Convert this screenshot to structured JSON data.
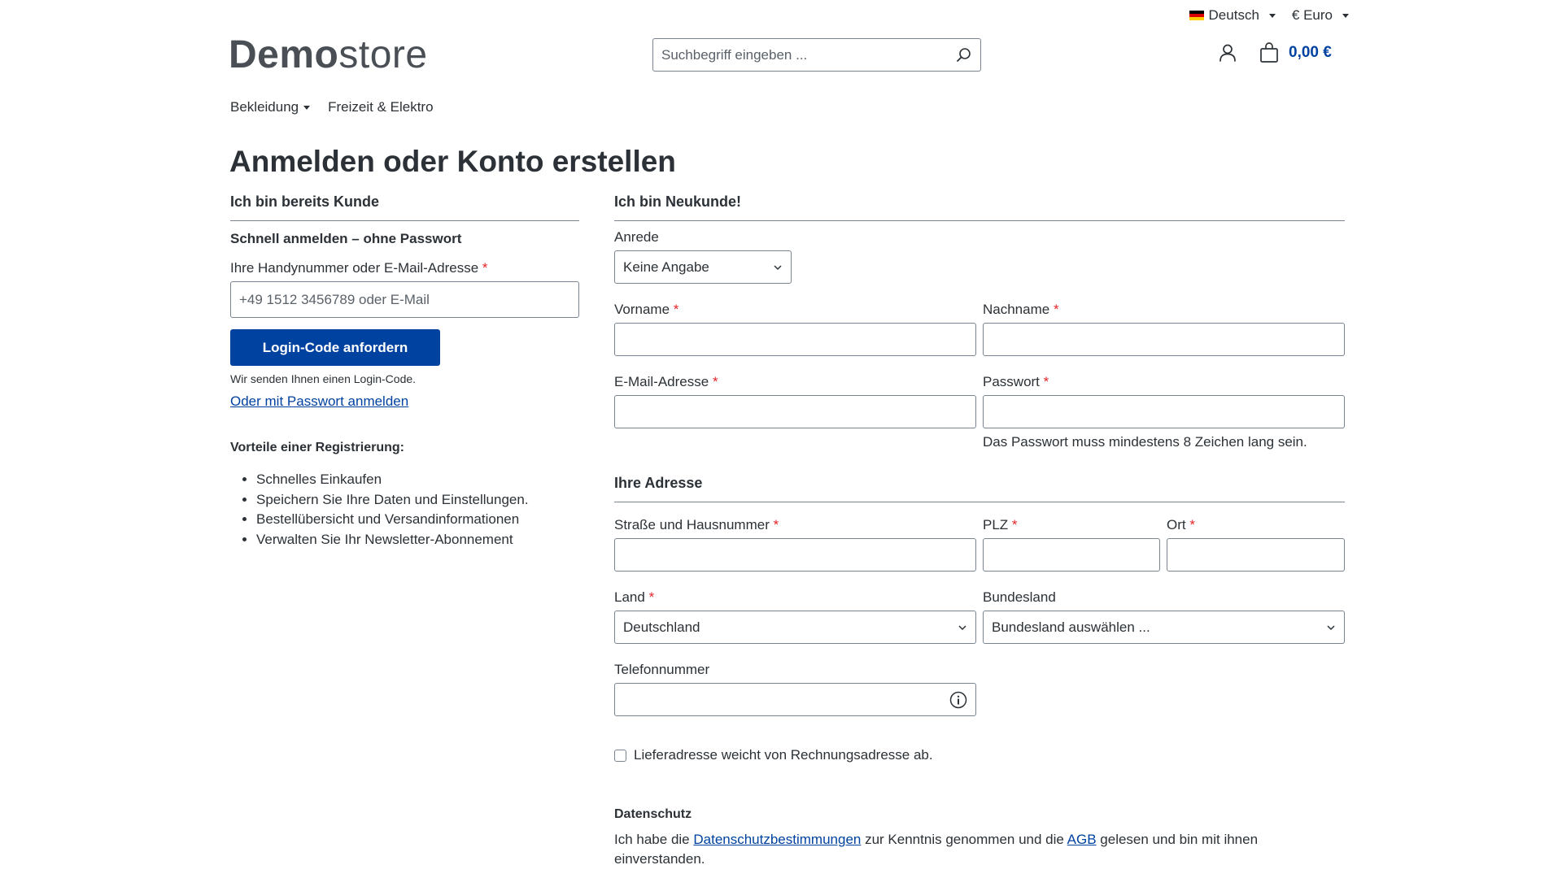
{
  "topbar": {
    "language": "Deutsch",
    "currency": "€ Euro",
    "flag_colors": [
      "#000000",
      "#dd0000",
      "#ffce00"
    ]
  },
  "header": {
    "logo_bold": "Demo",
    "logo_regular": "store",
    "search_placeholder": "Suchbegriff eingeben ...",
    "cart_total": "0,00 €"
  },
  "nav": {
    "items": [
      {
        "label": "Bekleidung",
        "has_dropdown": true
      },
      {
        "label": "Freizeit & Elektro",
        "has_dropdown": false
      }
    ]
  },
  "page": {
    "title": "Anmelden oder Konto erstellen"
  },
  "login": {
    "section_title": "Ich bin bereits Kunde",
    "subhead": "Schnell anmelden – ohne Passwort",
    "field_label": "Ihre Handynummer oder E-Mail-Adresse",
    "required_mark": "*",
    "field_placeholder": "+49 1512 3456789 oder E-Mail",
    "button_label": "Login-Code anfordern",
    "info_text": "Wir senden Ihnen einen Login-Code.",
    "password_link": "Oder mit Passwort anmelden",
    "benefits_title": "Vorteile einer Registrierung:",
    "benefits": [
      "Schnelles Einkaufen",
      "Speichern Sie Ihre Daten und Einstellungen.",
      "Bestellübersicht und Versandinformationen",
      "Verwalten Sie Ihr Newsletter-Abonnement"
    ]
  },
  "register": {
    "section_title": "Ich bin Neukunde!",
    "salutation_label": "Anrede",
    "salutation_value": "Keine Angabe",
    "firstname_label": "Vorname",
    "lastname_label": "Nachname",
    "email_label": "E-Mail-Adresse",
    "password_label": "Passwort",
    "password_hint": "Das Passwort muss mindestens 8 Zeichen lang sein.",
    "address_title": "Ihre Adresse",
    "street_label": "Straße und Hausnummer",
    "zip_label": "PLZ",
    "city_label": "Ort",
    "country_label": "Land",
    "country_value": "Deutschland",
    "state_label": "Bundesland",
    "state_value": "Bundesland auswählen ...",
    "phone_label": "Telefonnummer",
    "shipping_checkbox_label": "Lieferadresse weicht von Rechnungsadresse ab.",
    "privacy_title": "Datenschutz",
    "privacy_text_1": "Ich habe die ",
    "privacy_link": "Datenschutzbestimmungen",
    "privacy_text_2": " zur Kenntnis genommen und die ",
    "agb_link": "AGB",
    "privacy_text_3": " gelesen und bin mit ihnen einverstanden."
  },
  "colors": {
    "primary": "#0042a0",
    "required": "#e52427",
    "text": "#2b3136",
    "border": "#798490"
  }
}
